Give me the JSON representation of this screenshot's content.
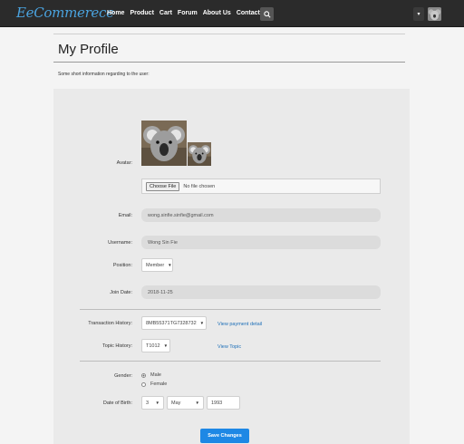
{
  "brand": {
    "first": "Ee",
    "rest": "Commerece"
  },
  "nav": {
    "links": [
      "Home",
      "Product",
      "Cart",
      "Forum",
      "About Us",
      "Contact Us"
    ],
    "search_icon": "search-icon",
    "user_caret": "▾"
  },
  "page": {
    "title": "My Profile",
    "subtitle": "Some short information regarding to the user:"
  },
  "form": {
    "avatar_label": "Avatar:",
    "file_button": "Choose File",
    "file_status": "No file chosen",
    "email_label": "Email:",
    "email_value": "wong.sinfie.sinfie@gmail.com",
    "username_label": "Username:",
    "username_value": "Wong Sin Fie",
    "position_label": "Position:",
    "position_value": "Member",
    "join_label": "Join Date:",
    "join_value": "2018-11-25",
    "transaction_label": "Transaction History:",
    "transaction_value": "8MB55371TG7328732",
    "transaction_link": "View payment detail",
    "topic_label": "Topic History:",
    "topic_value": "T1012",
    "topic_link": "View Topic",
    "gender_label": "Gender:",
    "gender_options": [
      "Male",
      "Female"
    ],
    "gender_selected": "Male",
    "dob_label": "Date of Birth:",
    "dob_day": "3",
    "dob_month": "May",
    "dob_year": "1993",
    "save_button": "Save Changes"
  },
  "colors": {
    "accent": "#1e88e5",
    "navbar": "#2b2b2b",
    "brand": "#4aa3df",
    "link": "#1d6fb8"
  }
}
